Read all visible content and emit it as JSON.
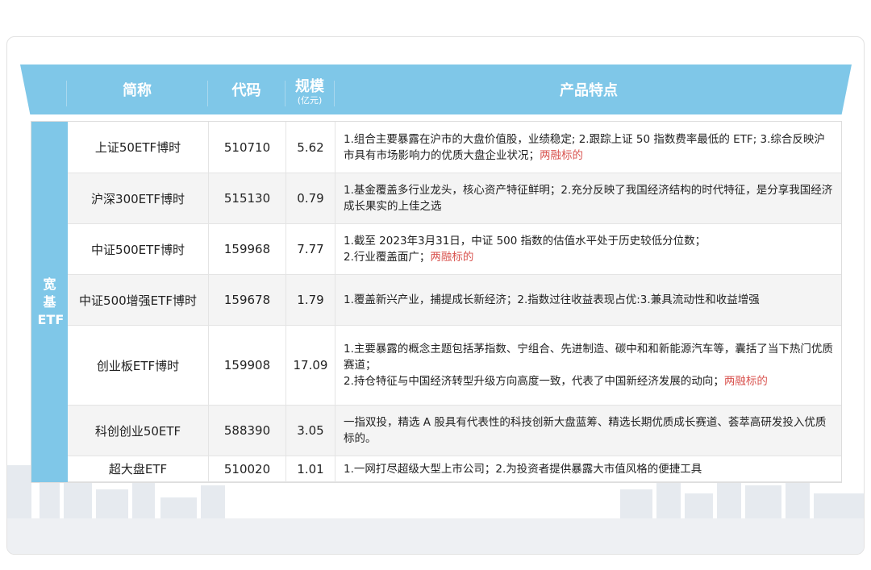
{
  "header": {
    "name": "简称",
    "code": "代码",
    "scale": "规模",
    "scale_unit": "(亿元)",
    "features": "产品特点"
  },
  "category": "宽基ETF",
  "rows": [
    {
      "name": "上证50ETF博时",
      "code": "510710",
      "scale": "5.62",
      "features": "1.组合主要暴露在沪市的大盘价值股，业绩稳定; 2.跟踪上证 50 指数费率最低的 ETF; 3.综合反映沪市具有市场影响力的优质大盘企业状况；",
      "tag": "两融标的"
    },
    {
      "name": "沪深300ETF博时",
      "code": "515130",
      "scale": "0.79",
      "features": "1.基金覆盖多行业龙头，核心资产特征鲜明；2.充分反映了我国经济结构的时代特征，是分享我国经济成长果实的上佳之选",
      "tag": ""
    },
    {
      "name": "中证500ETF博时",
      "code": "159968",
      "scale": "7.77",
      "features": "1.截至 2023年3月31日，中证 500 指数的估值水平处于历史较低分位数；\n2.行业覆盖面广；",
      "tag": "两融标的"
    },
    {
      "name": "中证500增强ETF博时",
      "code": "159678",
      "scale": "1.79",
      "features": "1.覆盖新兴产业，捕提成长新经济；2.指数过往收益表现占优:3.兼具流动性和收益增强",
      "tag": ""
    },
    {
      "name": "创业板ETF博时",
      "code": "159908",
      "scale": "17.09",
      "features": "1.主要暴露的概念主题包括茅指数、宁组合、先进制造、碳中和和新能源汽车等，囊括了当下热门优质赛道；\n2.持仓特征与中国经济转型升级方向高度一致，代表了中国新经济发展的动向；",
      "tag": "两融标的"
    },
    {
      "name": "科创创业50ETF",
      "code": "588390",
      "scale": "3.05",
      "features": "一指双投，精选 A 股具有代表性的科技创新大盘蓝筹、精选长期优质成长赛道、荟萃高研发投入优质标的。",
      "tag": ""
    },
    {
      "name": "超大盘ETF",
      "code": "510020",
      "scale": "1.01",
      "features": "1.一网打尽超级大型上市公司；2.为投资者提供暴露大市值风格的便捷工具",
      "tag": ""
    }
  ]
}
